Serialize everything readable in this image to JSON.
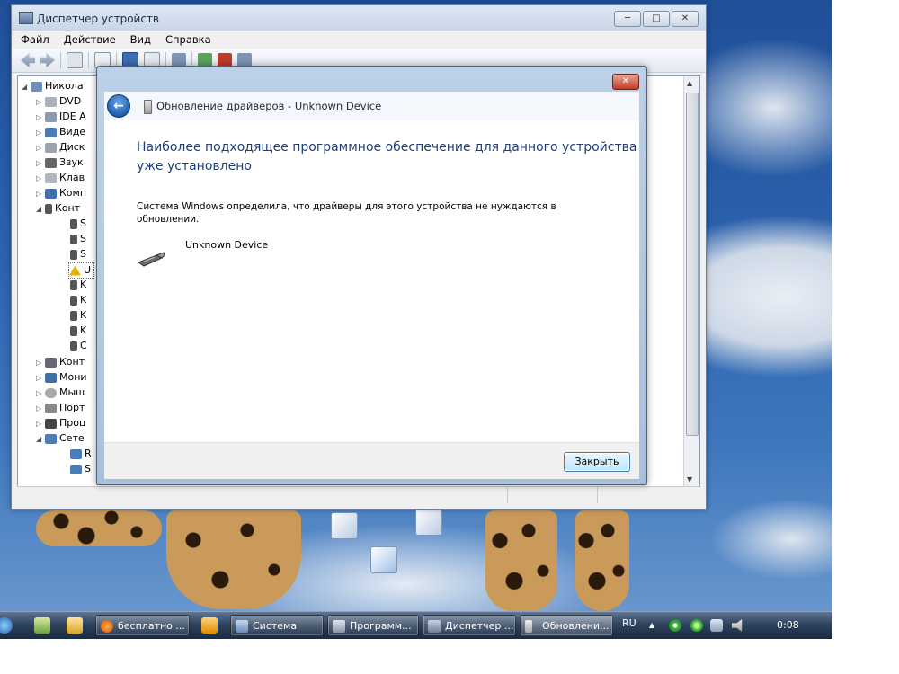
{
  "device_manager": {
    "title": "Диспетчер устройств",
    "caption_buttons": [
      "minimize",
      "maximize",
      "close"
    ],
    "menu": [
      "Файл",
      "Действие",
      "Вид",
      "Справка"
    ],
    "tree": [
      {
        "label": "Никола",
        "expanded": true,
        "level": 0
      },
      {
        "label": "DVD",
        "expanded": false,
        "level": 1
      },
      {
        "label": "IDE A",
        "expanded": false,
        "level": 1
      },
      {
        "label": "Виде",
        "expanded": false,
        "level": 1
      },
      {
        "label": "Диск",
        "expanded": false,
        "level": 1
      },
      {
        "label": "Звук",
        "expanded": false,
        "level": 1
      },
      {
        "label": "Клав",
        "expanded": false,
        "level": 1
      },
      {
        "label": "Комп",
        "expanded": false,
        "level": 1
      },
      {
        "label": "Конт",
        "expanded": true,
        "level": 1
      },
      {
        "label": "S",
        "level": 2
      },
      {
        "label": "S",
        "level": 2
      },
      {
        "label": "S",
        "level": 2
      },
      {
        "label": "U",
        "level": 2,
        "warning": true
      },
      {
        "label": "K",
        "level": 2
      },
      {
        "label": "K",
        "level": 2
      },
      {
        "label": "K",
        "level": 2
      },
      {
        "label": "K",
        "level": 2
      },
      {
        "label": "C",
        "level": 2
      },
      {
        "label": "Конт",
        "expanded": false,
        "level": 1
      },
      {
        "label": "Мони",
        "expanded": false,
        "level": 1
      },
      {
        "label": "Мыш",
        "expanded": false,
        "level": 1
      },
      {
        "label": "Порт",
        "expanded": false,
        "level": 1
      },
      {
        "label": "Проц",
        "expanded": false,
        "level": 1
      },
      {
        "label": "Сете",
        "expanded": true,
        "level": 1
      },
      {
        "label": "R",
        "level": 2
      },
      {
        "label": "S",
        "level": 2
      }
    ]
  },
  "dialog": {
    "title": "Обновление драйверов - Unknown Device",
    "heading": "Наиболее подходящее программное обеспечение для данного устройства уже установлено",
    "description": "Система Windows определила, что драйверы для этого устройства не нуждаются в обновлении.",
    "device_name": "Unknown Device",
    "close_button": "Закрыть"
  },
  "taskbar": {
    "tasks": [
      {
        "label": "бесплатно ...",
        "icon": "firefox-icon"
      },
      {
        "label": "Система",
        "icon": "system-icon"
      },
      {
        "label": "Программ...",
        "icon": "programs-icon"
      },
      {
        "label": "Диспетчер ...",
        "icon": "device-manager-icon"
      },
      {
        "label": "Обновлени...",
        "icon": "update-icon",
        "active": true
      }
    ],
    "language": "RU",
    "clock": "0:08"
  }
}
